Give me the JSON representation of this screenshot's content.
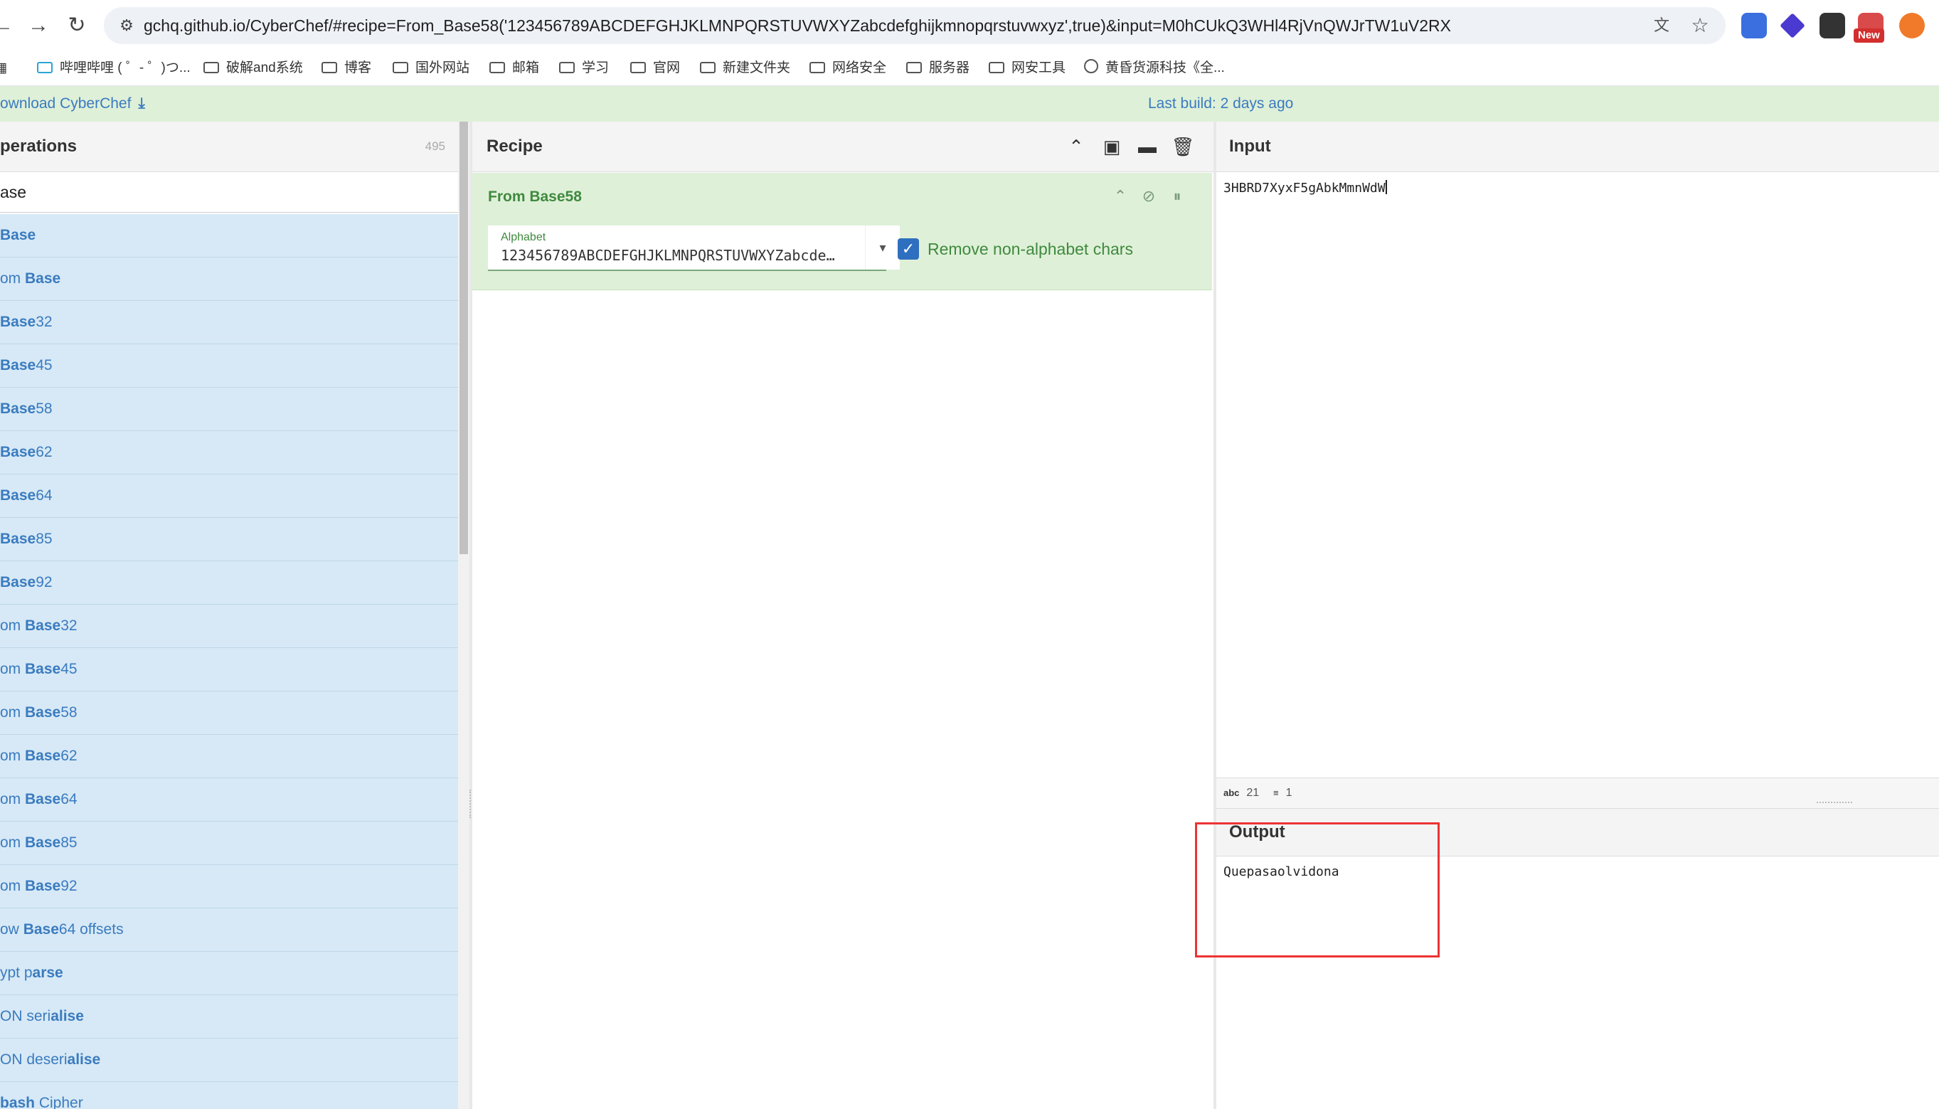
{
  "browser": {
    "url": "gchq.github.io/CyberChef/#recipe=From_Base58('123456789ABCDEFGHJKLMNPQRSTUVWXYZabcdefghijkmnopqrstuvwxyz',true)&input=M0hCUkQ3WHl4RjVnQWJrTW1uV2RX",
    "ext_badge": "New",
    "bookmarks": [
      "哔哩哔哩 ( ゜- ゜)つ...",
      "破解and系统",
      "博客",
      "国外网站",
      "邮箱",
      "学习",
      "官网",
      "新建文件夹",
      "网络安全",
      "服务器",
      "网安工具",
      "黄昏货源科技《全..."
    ]
  },
  "banner": {
    "download": "ownload CyberChef",
    "last_build": "Last build: 2 days ago"
  },
  "operations": {
    "title": "perations",
    "count": "495",
    "search": "ase",
    "items": [
      {
        "pre": "",
        "bold": "Base",
        "post": ""
      },
      {
        "pre": "om ",
        "bold": "Base",
        "post": ""
      },
      {
        "pre": "",
        "bold": "Base",
        "post": "32"
      },
      {
        "pre": "",
        "bold": "Base",
        "post": "45"
      },
      {
        "pre": "",
        "bold": "Base",
        "post": "58"
      },
      {
        "pre": "",
        "bold": "Base",
        "post": "62"
      },
      {
        "pre": "",
        "bold": "Base",
        "post": "64"
      },
      {
        "pre": "",
        "bold": "Base",
        "post": "85"
      },
      {
        "pre": "",
        "bold": "Base",
        "post": "92"
      },
      {
        "pre": "om ",
        "bold": "Base",
        "post": "32"
      },
      {
        "pre": "om ",
        "bold": "Base",
        "post": "45"
      },
      {
        "pre": "om ",
        "bold": "Base",
        "post": "58"
      },
      {
        "pre": "om ",
        "bold": "Base",
        "post": "62"
      },
      {
        "pre": "om ",
        "bold": "Base",
        "post": "64"
      },
      {
        "pre": "om ",
        "bold": "Base",
        "post": "85"
      },
      {
        "pre": "om ",
        "bold": "Base",
        "post": "92"
      },
      {
        "pre": "ow ",
        "bold": "Base",
        "post": "64 offsets"
      },
      {
        "pre": "ypt p",
        "bold": "arse",
        "post": ""
      },
      {
        "pre": "ON seri",
        "bold": "alise",
        "post": ""
      },
      {
        "pre": "ON deseri",
        "bold": "alise",
        "post": ""
      },
      {
        "pre": "",
        "bold": "bash",
        "post": " Cipher"
      }
    ]
  },
  "recipe": {
    "title": "Recipe",
    "operation": {
      "name": "From Base58",
      "alphabet_label": "Alphabet",
      "alphabet_value": "123456789ABCDEFGHJKLMNPQRSTUVWXYZabcdefghijkmnopqrstuvwxyz",
      "remove_label": "Remove non-alphabet chars",
      "remove_checked": true
    }
  },
  "input": {
    "title": "Input",
    "text": "3HBRD7XyxF5gAbkMmnWdW",
    "chars": "21",
    "lines": "1"
  },
  "output": {
    "title": "Output",
    "text": "Quepasaolvidona"
  }
}
